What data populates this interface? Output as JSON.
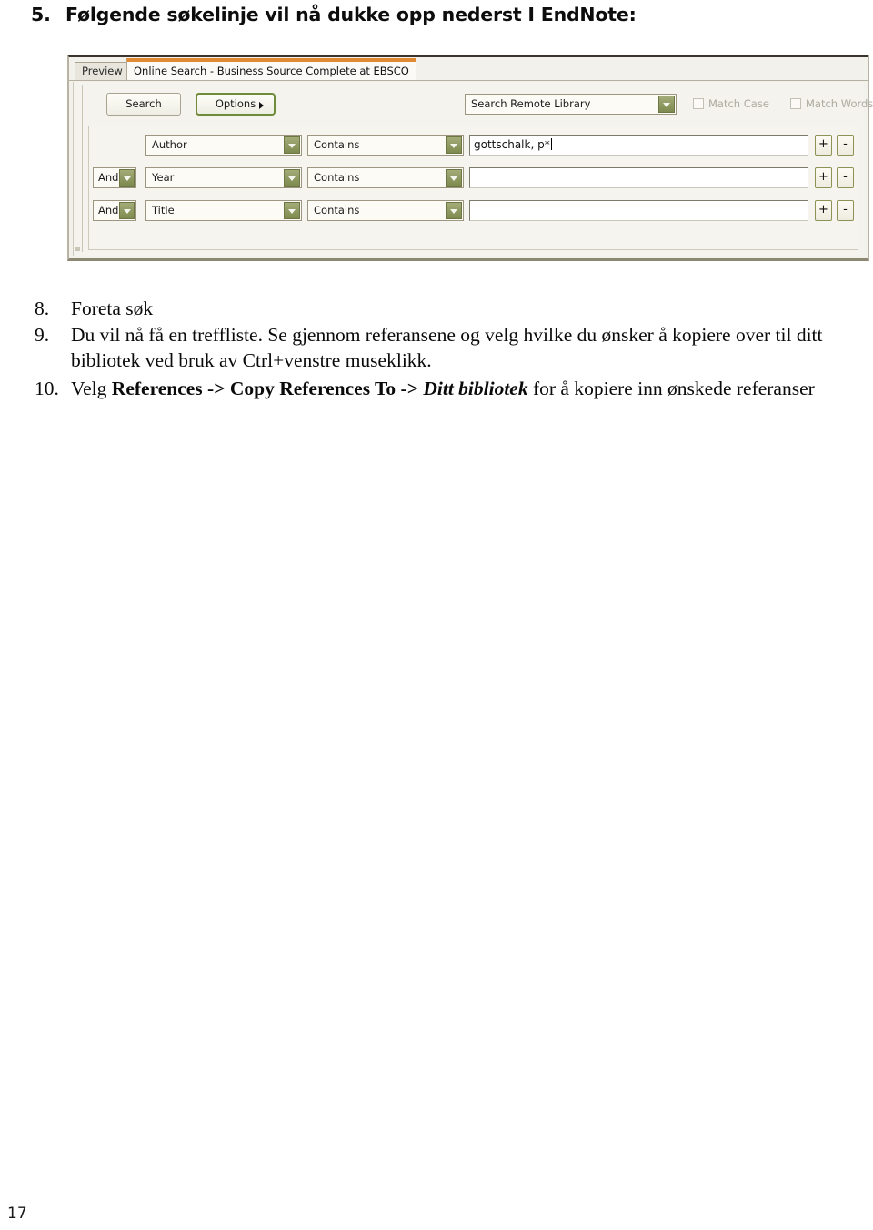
{
  "document": {
    "intro": {
      "number": "5.",
      "text": "Følgende søkelinje vil nå dukke opp nederst I EndNote:"
    },
    "page_number": "17"
  },
  "screenshot": {
    "tabs": [
      {
        "label": "Preview",
        "active": false
      },
      {
        "label": "Online Search - Business Source Complete at EBSCO",
        "active": true
      }
    ],
    "toolbar": {
      "search_button": "Search",
      "options_button": "Options",
      "options_caret": "caret-right-icon",
      "library_select": "Search Remote Library",
      "match_case": "Match Case",
      "match_words": "Match Words"
    },
    "search_rows": [
      {
        "boolean": "",
        "field": "Author",
        "operator": "Contains",
        "term": "gottschalk, p*",
        "add": "+",
        "remove": "-"
      },
      {
        "boolean": "And",
        "field": "Year",
        "operator": "Contains",
        "term": "",
        "add": "+",
        "remove": "-"
      },
      {
        "boolean": "And",
        "field": "Title",
        "operator": "Contains",
        "term": "",
        "add": "+",
        "remove": "-"
      }
    ],
    "colors": {
      "active_tab_accent": "#e08a33",
      "dropdown_arrow": "#7e8a4f",
      "options_focus_border": "#6e8c3a",
      "panel_background": "#f4f3ee"
    }
  },
  "steps": [
    {
      "number": "8.",
      "parts": [
        {
          "type": "text",
          "value": "Foreta søk"
        }
      ]
    },
    {
      "number": "9.",
      "parts": [
        {
          "type": "text",
          "value": "Du vil nå få en treffliste. Se gjennom referansene og velg hvilke du ønsker å kopiere over til ditt bibliotek ved bruk av Ctrl+venstre museklikk."
        }
      ]
    },
    {
      "number": "10.",
      "parts": [
        {
          "type": "text",
          "value": "Velg "
        },
        {
          "type": "bold",
          "value": "References -> Copy References To -> "
        },
        {
          "type": "bolditalic",
          "value": "Ditt bibliotek"
        },
        {
          "type": "text",
          "value": " for å kopiere inn ønskede referanser"
        }
      ]
    }
  ]
}
